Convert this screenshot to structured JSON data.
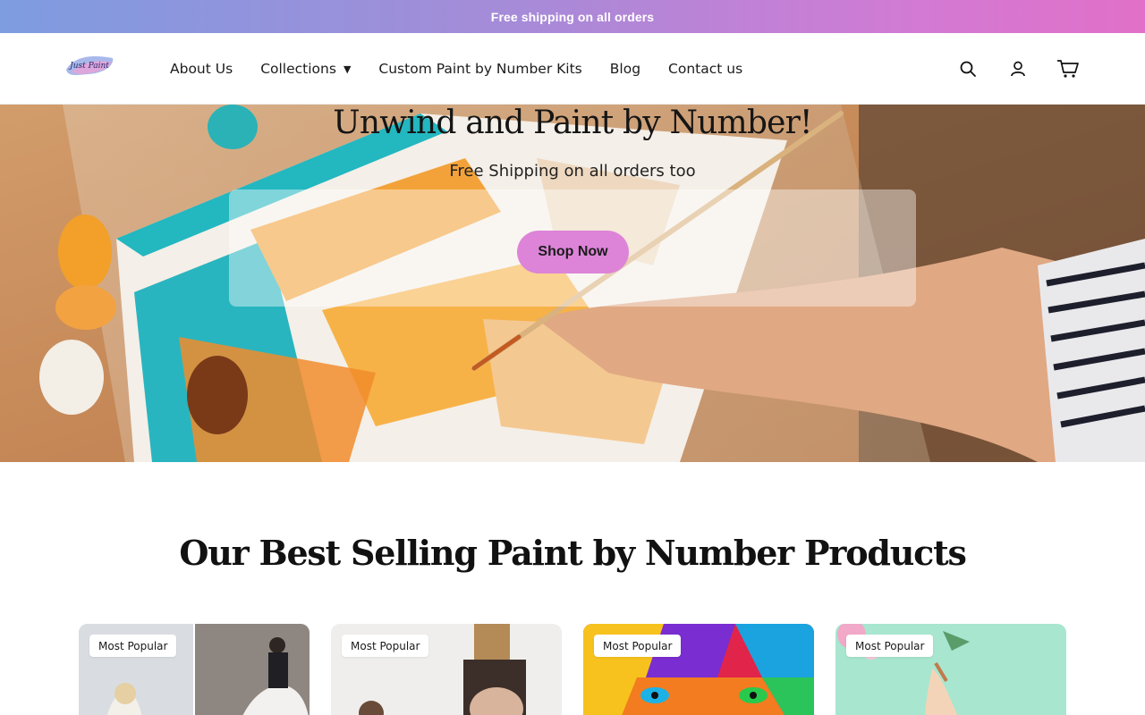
{
  "announcement": {
    "text": "Free shipping on all orders"
  },
  "header": {
    "logo_text": "Just Paint",
    "nav": [
      {
        "label": "About Us"
      },
      {
        "label": "Collections",
        "has_dropdown": true
      },
      {
        "label": "Custom Paint by Number Kits"
      },
      {
        "label": "Blog"
      },
      {
        "label": "Contact us"
      }
    ],
    "icons": [
      "search-icon",
      "account-icon",
      "cart-icon"
    ]
  },
  "hero": {
    "title": "Unwind and Paint by Number!",
    "subtitle": "Free Shipping on all orders too",
    "cta_label": "Shop Now"
  },
  "best_sellers": {
    "title": "Our Best Selling Paint by Number Products",
    "products": [
      {
        "badge": "Most Popular",
        "image": "wedding-couple-photo"
      },
      {
        "badge": "Most Popular",
        "image": "couple-with-easel-photo"
      },
      {
        "badge": "Most Popular",
        "image": "colorful-lion-painting"
      },
      {
        "badge": "Most Popular",
        "image": "flower-unicorn-illustration"
      }
    ]
  },
  "colors": {
    "announcement_gradient_start": "#7e9ce0",
    "announcement_gradient_end": "#e170c8",
    "cta_background": "#dd84d8"
  }
}
